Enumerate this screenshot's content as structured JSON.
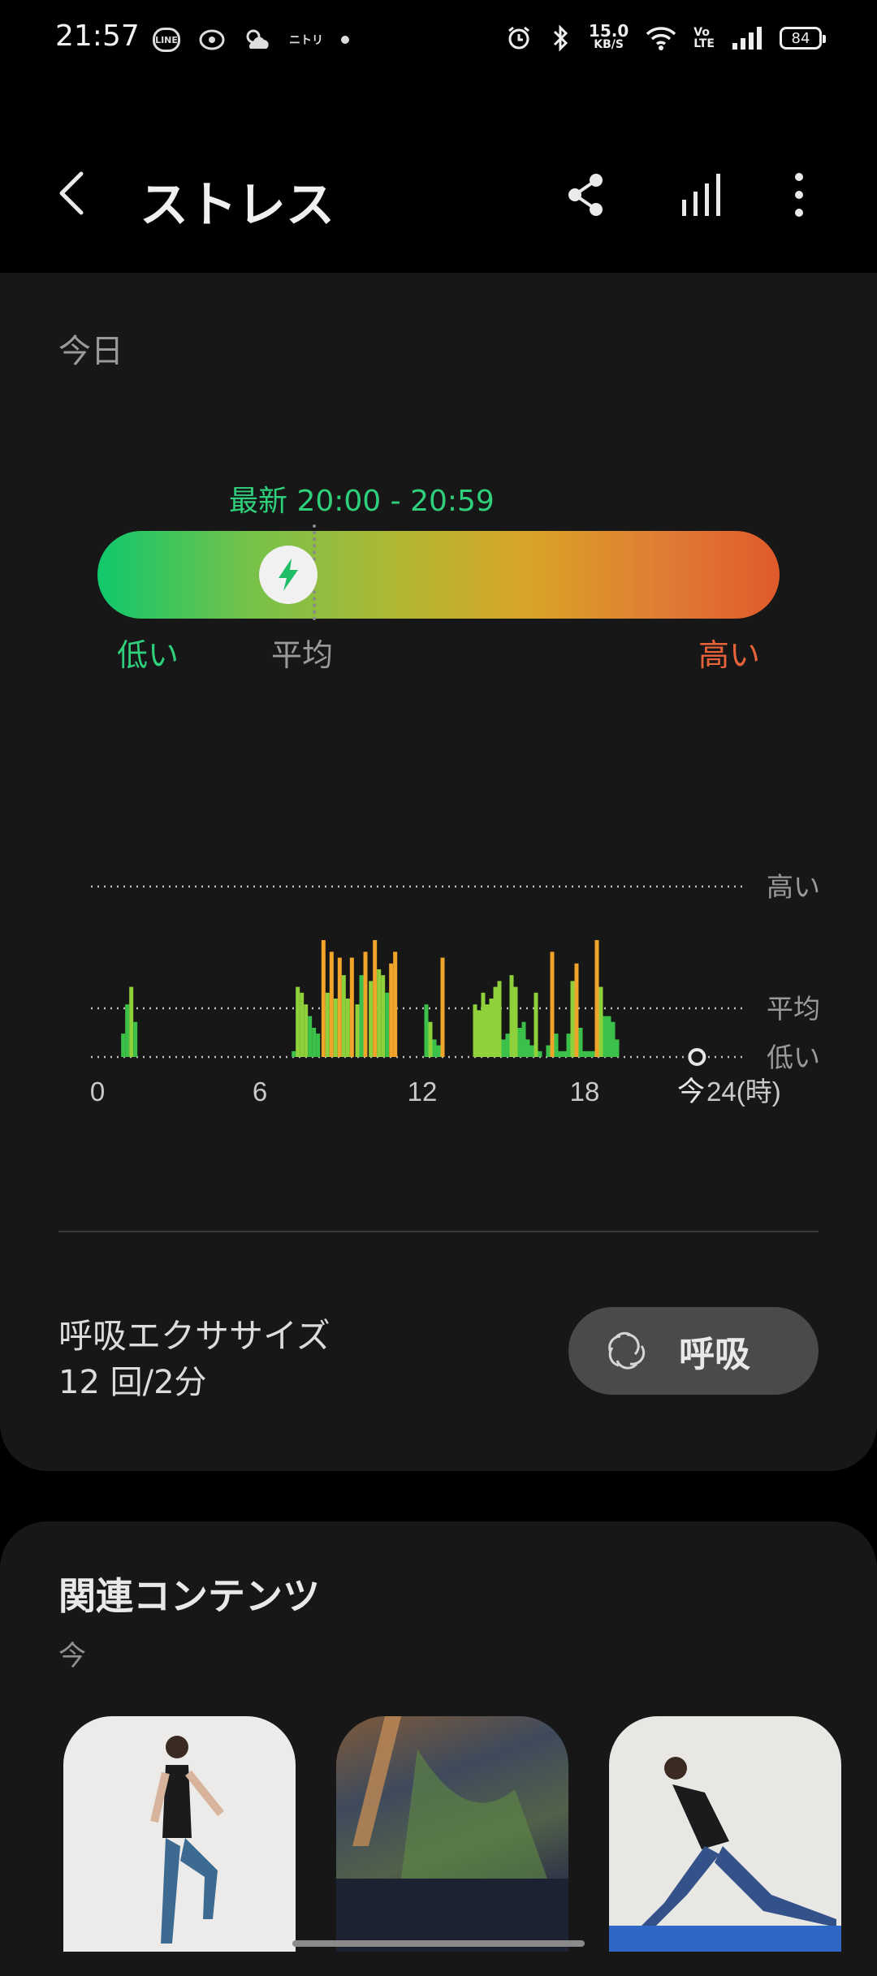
{
  "status_bar": {
    "time": "21:57",
    "notif_icons": [
      "line-icon",
      "eye-app-icon",
      "weather-icon",
      "nitori-icon"
    ],
    "line_label": "LINE",
    "nitori_label": "ニトリ",
    "net_speed_value": "15.0",
    "net_speed_unit": "KB/S",
    "volte": "Vo\nLTE",
    "battery": "84"
  },
  "header": {
    "title": "ストレス"
  },
  "today_card": {
    "label": "今日",
    "latest": "最新 20:00 - 20:59",
    "gauge_level": 0.28,
    "gauge_low": "低い",
    "gauge_avg": "平均",
    "gauge_high": "高い",
    "colors": {
      "low": "#2fd07b",
      "high": "#e8623a",
      "bar_green": "#3bc04a",
      "bar_light": "#8fd13a",
      "bar_orange": "#f0a52a"
    }
  },
  "chart_data": {
    "type": "bar",
    "x_ticks": [
      "0",
      "6",
      "12",
      "18"
    ],
    "now_label": "今",
    "end_label": "24(時)",
    "y_levels": [
      "高い",
      "平均",
      "低い"
    ],
    "xlim": [
      0,
      24
    ],
    "bars": [
      [
        1.1,
        0.2,
        "g"
      ],
      [
        1.25,
        0.45,
        "g"
      ],
      [
        1.4,
        0.6,
        "l"
      ],
      [
        1.55,
        0.3,
        "g"
      ],
      [
        7.4,
        0.05,
        "g"
      ],
      [
        7.55,
        0.6,
        "l"
      ],
      [
        7.7,
        0.55,
        "l"
      ],
      [
        7.85,
        0.45,
        "l"
      ],
      [
        8.0,
        0.35,
        "g"
      ],
      [
        8.15,
        0.25,
        "g"
      ],
      [
        8.3,
        0.2,
        "g"
      ],
      [
        8.5,
        1.0,
        "o"
      ],
      [
        8.65,
        0.55,
        "l"
      ],
      [
        8.8,
        0.9,
        "o"
      ],
      [
        8.95,
        0.5,
        "l"
      ],
      [
        9.1,
        0.85,
        "o"
      ],
      [
        9.25,
        0.7,
        "l"
      ],
      [
        9.4,
        0.5,
        "l"
      ],
      [
        9.55,
        0.85,
        "o"
      ],
      [
        9.75,
        0.45,
        "l"
      ],
      [
        9.9,
        0.7,
        "g"
      ],
      [
        10.05,
        0.9,
        "o"
      ],
      [
        10.25,
        0.65,
        "l"
      ],
      [
        10.4,
        1.0,
        "o"
      ],
      [
        10.55,
        0.75,
        "l"
      ],
      [
        10.7,
        0.7,
        "l"
      ],
      [
        10.85,
        0.55,
        "g"
      ],
      [
        11.0,
        0.8,
        "o"
      ],
      [
        11.15,
        0.9,
        "o"
      ],
      [
        12.3,
        0.45,
        "g"
      ],
      [
        12.45,
        0.3,
        "l"
      ],
      [
        12.6,
        0.15,
        "g"
      ],
      [
        12.75,
        0.1,
        "g"
      ],
      [
        12.9,
        0.85,
        "o"
      ],
      [
        14.1,
        0.45,
        "l"
      ],
      [
        14.25,
        0.4,
        "l"
      ],
      [
        14.4,
        0.55,
        "l"
      ],
      [
        14.55,
        0.45,
        "l"
      ],
      [
        14.7,
        0.5,
        "l"
      ],
      [
        14.85,
        0.6,
        "l"
      ],
      [
        15.0,
        0.65,
        "l"
      ],
      [
        15.15,
        0.15,
        "g"
      ],
      [
        15.3,
        0.2,
        "g"
      ],
      [
        15.45,
        0.7,
        "l"
      ],
      [
        15.6,
        0.6,
        "l"
      ],
      [
        15.75,
        0.25,
        "g"
      ],
      [
        15.9,
        0.3,
        "g"
      ],
      [
        16.05,
        0.15,
        "g"
      ],
      [
        16.2,
        0.1,
        "g"
      ],
      [
        16.35,
        0.55,
        "l"
      ],
      [
        16.5,
        0.05,
        "g"
      ],
      [
        16.8,
        0.1,
        "g"
      ],
      [
        16.95,
        0.9,
        "o"
      ],
      [
        17.1,
        0.2,
        "g"
      ],
      [
        17.25,
        0.05,
        "g"
      ],
      [
        17.4,
        0.05,
        "g"
      ],
      [
        17.55,
        0.2,
        "g"
      ],
      [
        17.7,
        0.65,
        "l"
      ],
      [
        17.85,
        0.8,
        "o"
      ],
      [
        18.0,
        0.25,
        "g"
      ],
      [
        18.15,
        0.05,
        "g"
      ],
      [
        18.3,
        0.05,
        "g"
      ],
      [
        18.45,
        0.05,
        "g"
      ],
      [
        18.6,
        1.0,
        "o"
      ],
      [
        18.75,
        0.6,
        "l"
      ],
      [
        18.9,
        0.35,
        "g"
      ],
      [
        19.05,
        0.35,
        "g"
      ],
      [
        19.2,
        0.3,
        "g"
      ],
      [
        19.35,
        0.15,
        "g"
      ]
    ]
  },
  "breathing": {
    "title": "呼吸エクササイズ",
    "subtitle": "12 回/2分",
    "button_label": "呼吸"
  },
  "related": {
    "title": "関連コンテンツ",
    "subtitle": "今",
    "thumbs": [
      "yoga-stretch-thumbnail",
      "aurora-thumbnail",
      "yoga-lunge-thumbnail"
    ]
  }
}
